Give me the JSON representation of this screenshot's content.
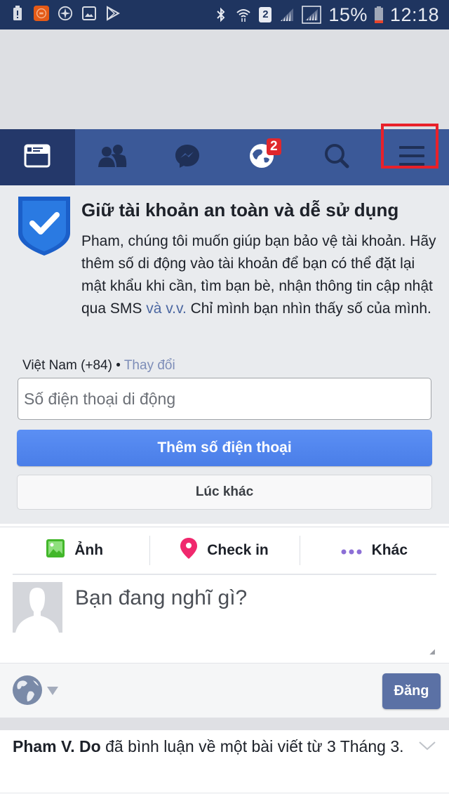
{
  "status_bar": {
    "left_icons": [
      "battery-alert-icon",
      "recorder-app-icon",
      "compass-app-icon",
      "gallery-icon",
      "play-store-icon"
    ],
    "right_icons": [
      "bluetooth-icon",
      "wifi-icon",
      "sim2-icon",
      "signal-icon",
      "signal-roaming-icon"
    ],
    "sim_label": "2",
    "battery_percent": "15%",
    "time": "12:18"
  },
  "nav": {
    "items": [
      {
        "name": "news-feed",
        "icon": "news-feed-icon",
        "active": true
      },
      {
        "name": "friend-requests",
        "icon": "friends-icon",
        "active": false
      },
      {
        "name": "messages",
        "icon": "messenger-icon",
        "active": false
      },
      {
        "name": "notifications",
        "icon": "globe-notifications-icon",
        "active": false,
        "badge": "2"
      },
      {
        "name": "search",
        "icon": "search-icon",
        "active": false
      },
      {
        "name": "menu",
        "icon": "hamburger-menu-icon",
        "active": false,
        "highlighted": true
      }
    ],
    "notification_badge": "2"
  },
  "security_card": {
    "title": "Giữ tài khoản an toàn và dễ sử dụng",
    "body_part1": "Pham, chúng tôi muốn giúp bạn bảo vệ tài khoản. Hãy thêm số di động vào tài khoản để bạn có thể đặt lại mật khẩu khi cần, tìm bạn bè, nhận thông tin cập nhật qua SMS ",
    "body_link": "và v.v.",
    "body_part2": " Chỉ mình bạn nhìn thấy số của mình.",
    "country": "Việt Nam (+84) •",
    "change_link": "Thay đổi",
    "phone_placeholder": "Số điện thoại di động",
    "add_phone_button": "Thêm số điện thoại",
    "later_button": "Lúc khác"
  },
  "composer": {
    "actions": [
      {
        "label": "Ảnh",
        "icon": "photo-icon"
      },
      {
        "label": "Check in",
        "icon": "location-pin-icon"
      },
      {
        "label": "Khác",
        "icon": "more-dots-icon"
      }
    ],
    "placeholder": "Bạn đang nghĩ gì?",
    "privacy": "public-globe-icon",
    "post_button": "Đăng"
  },
  "story": {
    "author": "Pham V. Do",
    "text": " đã bình luận về một bài viết từ 3 Tháng 3."
  },
  "colors": {
    "status_bar": "#1f3560",
    "nav_bar": "#3b5998",
    "nav_active": "#24386a",
    "badge": "#e0272c",
    "primary_button": "#4a7ee8",
    "post_button": "#5b71a5",
    "highlight_box": "#e8212a"
  }
}
